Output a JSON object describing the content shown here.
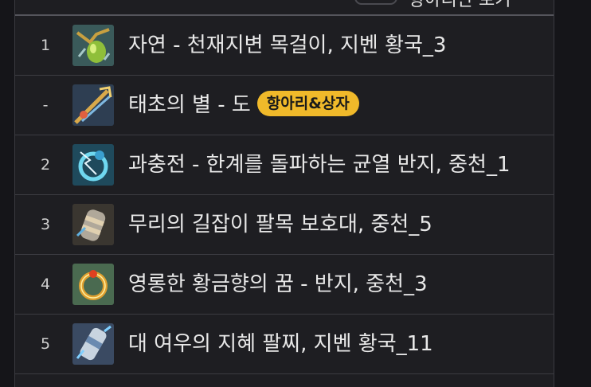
{
  "header": {
    "label": "항아리만 보기"
  },
  "rows": [
    {
      "rank": "1",
      "name": "자연 - 천재지변 목걸이, 지벤 황국_3",
      "icon": "necklace-icon",
      "badge": ""
    },
    {
      "rank": "-",
      "name": "태초의 별 - 도",
      "icon": "weapon-icon",
      "badge": "항아리&상자"
    },
    {
      "rank": "2",
      "name": "과충전 - 한계를 돌파하는 균열 반지, 중천_1",
      "icon": "ring-icon",
      "badge": ""
    },
    {
      "rank": "3",
      "name": "무리의 길잡이 팔목 보호대, 중천_5",
      "icon": "bracer-icon",
      "badge": ""
    },
    {
      "rank": "4",
      "name": "영롱한 황금향의 꿈 - 반지, 중천_3",
      "icon": "gold-ring-icon",
      "badge": ""
    },
    {
      "rank": "5",
      "name": "대 여우의 지혜 팔찌, 지벤 황국_11",
      "icon": "bracelet-icon",
      "badge": ""
    }
  ],
  "colors": {
    "badge": "#f0b92a",
    "background": "#1e1e22"
  }
}
